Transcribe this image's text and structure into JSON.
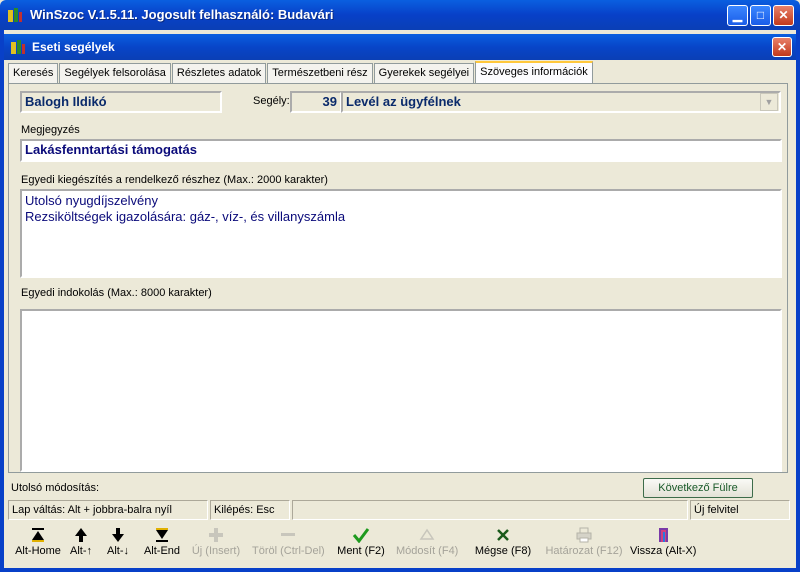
{
  "window": {
    "title": "WinSzoc V.1.5.11.  Jogosult felhasználó: Budavári",
    "btn_min": "▁",
    "btn_max": "□",
    "btn_close": "✕"
  },
  "dialog": {
    "title": "Eseti segélyek",
    "btn_close": "✕"
  },
  "tabs": [
    {
      "label": "Keresés"
    },
    {
      "label": "Segélyek felsorolása"
    },
    {
      "label": "Részletes adatok"
    },
    {
      "label": "Természetbeni rész"
    },
    {
      "label": "Gyerekek segélyei"
    },
    {
      "label": "Szöveges információk"
    }
  ],
  "active_tab_index": 5,
  "form": {
    "client_name": "Balogh Ildikó",
    "segely_label": "Segély:",
    "segely_number": "39",
    "segely_type": "Levél az ügyfélnek",
    "megjegyzes_label": "Megjegyzés",
    "megjegyzes_value": "Lakásfenntartási támogatás",
    "kiegeszites_label": "Egyedi kiegészítés a rendelkező részhez  (Max.: 2000 karakter)",
    "kiegeszites_lines": [
      "Utolsó nyugdíjszelvény",
      "Rezsiköltségek igazolására: gáz-, víz-, és villanyszámla"
    ],
    "indokolas_label": "Egyedi indokolás (Max.: 8000 karakter)",
    "indokolas_value": ""
  },
  "footer": {
    "last_modified_label": "Utolsó módosítás:",
    "next_tab_button": "Következő Fülre"
  },
  "status": {
    "tab_switch": "Lap váltás: Alt + jobbra-balra nyíl",
    "exit": "Kilépés: Esc",
    "middle": "",
    "mode": "Új felvitel"
  },
  "toolbar": [
    {
      "label": "Alt-Home",
      "icon": "first-icon",
      "enabled": true
    },
    {
      "label": "Alt-↑",
      "icon": "up-arrow-icon",
      "enabled": true
    },
    {
      "label": "Alt-↓",
      "icon": "down-arrow-icon",
      "enabled": true
    },
    {
      "label": "Alt-End",
      "icon": "last-icon",
      "enabled": true
    },
    {
      "label": "Új (Insert)",
      "icon": "plus-icon",
      "enabled": false
    },
    {
      "label": "Töröl (Ctrl-Del)",
      "icon": "minus-icon",
      "enabled": false
    },
    {
      "label": "Ment (F2)",
      "icon": "checkmark-icon",
      "enabled": true
    },
    {
      "label": "Módosít (F4)",
      "icon": "triangle-icon",
      "enabled": false
    },
    {
      "label": "Mégse (F8)",
      "icon": "cancel-x-icon",
      "enabled": true
    },
    {
      "label": "Határozat (F12)",
      "icon": "printer-icon",
      "enabled": false
    },
    {
      "label": "Vissza (Alt-X)",
      "icon": "exit-door-icon",
      "enabled": true
    }
  ],
  "colors": {
    "titlebar": "#0840c8",
    "text_blue": "#0a0a7a",
    "active_tab": "#ffc83c",
    "save_green": "#1e9a1e"
  }
}
